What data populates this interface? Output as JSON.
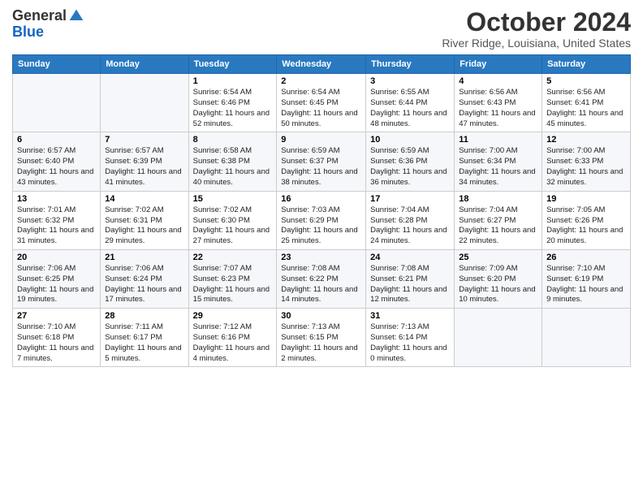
{
  "header": {
    "logo_general": "General",
    "logo_blue": "Blue",
    "title": "October 2024",
    "location": "River Ridge, Louisiana, United States"
  },
  "days_of_week": [
    "Sunday",
    "Monday",
    "Tuesday",
    "Wednesday",
    "Thursday",
    "Friday",
    "Saturday"
  ],
  "weeks": [
    [
      {
        "day": "",
        "text": ""
      },
      {
        "day": "",
        "text": ""
      },
      {
        "day": "1",
        "text": "Sunrise: 6:54 AM\nSunset: 6:46 PM\nDaylight: 11 hours and 52 minutes."
      },
      {
        "day": "2",
        "text": "Sunrise: 6:54 AM\nSunset: 6:45 PM\nDaylight: 11 hours and 50 minutes."
      },
      {
        "day": "3",
        "text": "Sunrise: 6:55 AM\nSunset: 6:44 PM\nDaylight: 11 hours and 48 minutes."
      },
      {
        "day": "4",
        "text": "Sunrise: 6:56 AM\nSunset: 6:43 PM\nDaylight: 11 hours and 47 minutes."
      },
      {
        "day": "5",
        "text": "Sunrise: 6:56 AM\nSunset: 6:41 PM\nDaylight: 11 hours and 45 minutes."
      }
    ],
    [
      {
        "day": "6",
        "text": "Sunrise: 6:57 AM\nSunset: 6:40 PM\nDaylight: 11 hours and 43 minutes."
      },
      {
        "day": "7",
        "text": "Sunrise: 6:57 AM\nSunset: 6:39 PM\nDaylight: 11 hours and 41 minutes."
      },
      {
        "day": "8",
        "text": "Sunrise: 6:58 AM\nSunset: 6:38 PM\nDaylight: 11 hours and 40 minutes."
      },
      {
        "day": "9",
        "text": "Sunrise: 6:59 AM\nSunset: 6:37 PM\nDaylight: 11 hours and 38 minutes."
      },
      {
        "day": "10",
        "text": "Sunrise: 6:59 AM\nSunset: 6:36 PM\nDaylight: 11 hours and 36 minutes."
      },
      {
        "day": "11",
        "text": "Sunrise: 7:00 AM\nSunset: 6:34 PM\nDaylight: 11 hours and 34 minutes."
      },
      {
        "day": "12",
        "text": "Sunrise: 7:00 AM\nSunset: 6:33 PM\nDaylight: 11 hours and 32 minutes."
      }
    ],
    [
      {
        "day": "13",
        "text": "Sunrise: 7:01 AM\nSunset: 6:32 PM\nDaylight: 11 hours and 31 minutes."
      },
      {
        "day": "14",
        "text": "Sunrise: 7:02 AM\nSunset: 6:31 PM\nDaylight: 11 hours and 29 minutes."
      },
      {
        "day": "15",
        "text": "Sunrise: 7:02 AM\nSunset: 6:30 PM\nDaylight: 11 hours and 27 minutes."
      },
      {
        "day": "16",
        "text": "Sunrise: 7:03 AM\nSunset: 6:29 PM\nDaylight: 11 hours and 25 minutes."
      },
      {
        "day": "17",
        "text": "Sunrise: 7:04 AM\nSunset: 6:28 PM\nDaylight: 11 hours and 24 minutes."
      },
      {
        "day": "18",
        "text": "Sunrise: 7:04 AM\nSunset: 6:27 PM\nDaylight: 11 hours and 22 minutes."
      },
      {
        "day": "19",
        "text": "Sunrise: 7:05 AM\nSunset: 6:26 PM\nDaylight: 11 hours and 20 minutes."
      }
    ],
    [
      {
        "day": "20",
        "text": "Sunrise: 7:06 AM\nSunset: 6:25 PM\nDaylight: 11 hours and 19 minutes."
      },
      {
        "day": "21",
        "text": "Sunrise: 7:06 AM\nSunset: 6:24 PM\nDaylight: 11 hours and 17 minutes."
      },
      {
        "day": "22",
        "text": "Sunrise: 7:07 AM\nSunset: 6:23 PM\nDaylight: 11 hours and 15 minutes."
      },
      {
        "day": "23",
        "text": "Sunrise: 7:08 AM\nSunset: 6:22 PM\nDaylight: 11 hours and 14 minutes."
      },
      {
        "day": "24",
        "text": "Sunrise: 7:08 AM\nSunset: 6:21 PM\nDaylight: 11 hours and 12 minutes."
      },
      {
        "day": "25",
        "text": "Sunrise: 7:09 AM\nSunset: 6:20 PM\nDaylight: 11 hours and 10 minutes."
      },
      {
        "day": "26",
        "text": "Sunrise: 7:10 AM\nSunset: 6:19 PM\nDaylight: 11 hours and 9 minutes."
      }
    ],
    [
      {
        "day": "27",
        "text": "Sunrise: 7:10 AM\nSunset: 6:18 PM\nDaylight: 11 hours and 7 minutes."
      },
      {
        "day": "28",
        "text": "Sunrise: 7:11 AM\nSunset: 6:17 PM\nDaylight: 11 hours and 5 minutes."
      },
      {
        "day": "29",
        "text": "Sunrise: 7:12 AM\nSunset: 6:16 PM\nDaylight: 11 hours and 4 minutes."
      },
      {
        "day": "30",
        "text": "Sunrise: 7:13 AM\nSunset: 6:15 PM\nDaylight: 11 hours and 2 minutes."
      },
      {
        "day": "31",
        "text": "Sunrise: 7:13 AM\nSunset: 6:14 PM\nDaylight: 11 hours and 0 minutes."
      },
      {
        "day": "",
        "text": ""
      },
      {
        "day": "",
        "text": ""
      }
    ]
  ]
}
